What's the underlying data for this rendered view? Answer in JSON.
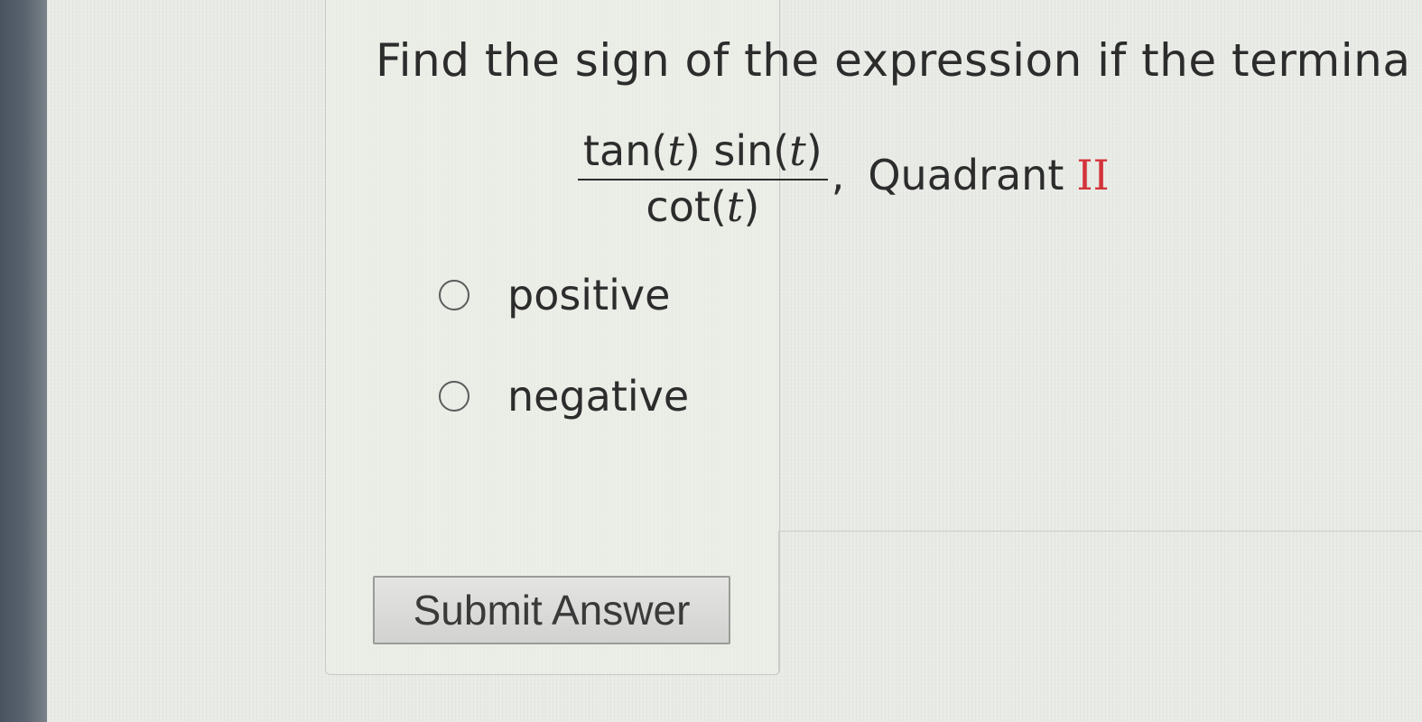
{
  "question": {
    "prompt": "Find the sign of the expression if the termina",
    "expression": {
      "numerator_parts": [
        "tan(",
        "t",
        ") sin(",
        "t",
        ")"
      ],
      "denominator_parts": [
        "cot(",
        "t",
        ")"
      ],
      "separator": ",",
      "quadrant_word": "Quadrant",
      "quadrant_numeral": "II"
    }
  },
  "options": [
    {
      "label": "positive",
      "selected": false
    },
    {
      "label": "negative",
      "selected": false
    }
  ],
  "submit": {
    "label": "Submit Answer"
  },
  "colors": {
    "quadrant_numeral": "#d3343a",
    "text": "#2c2c2c"
  }
}
